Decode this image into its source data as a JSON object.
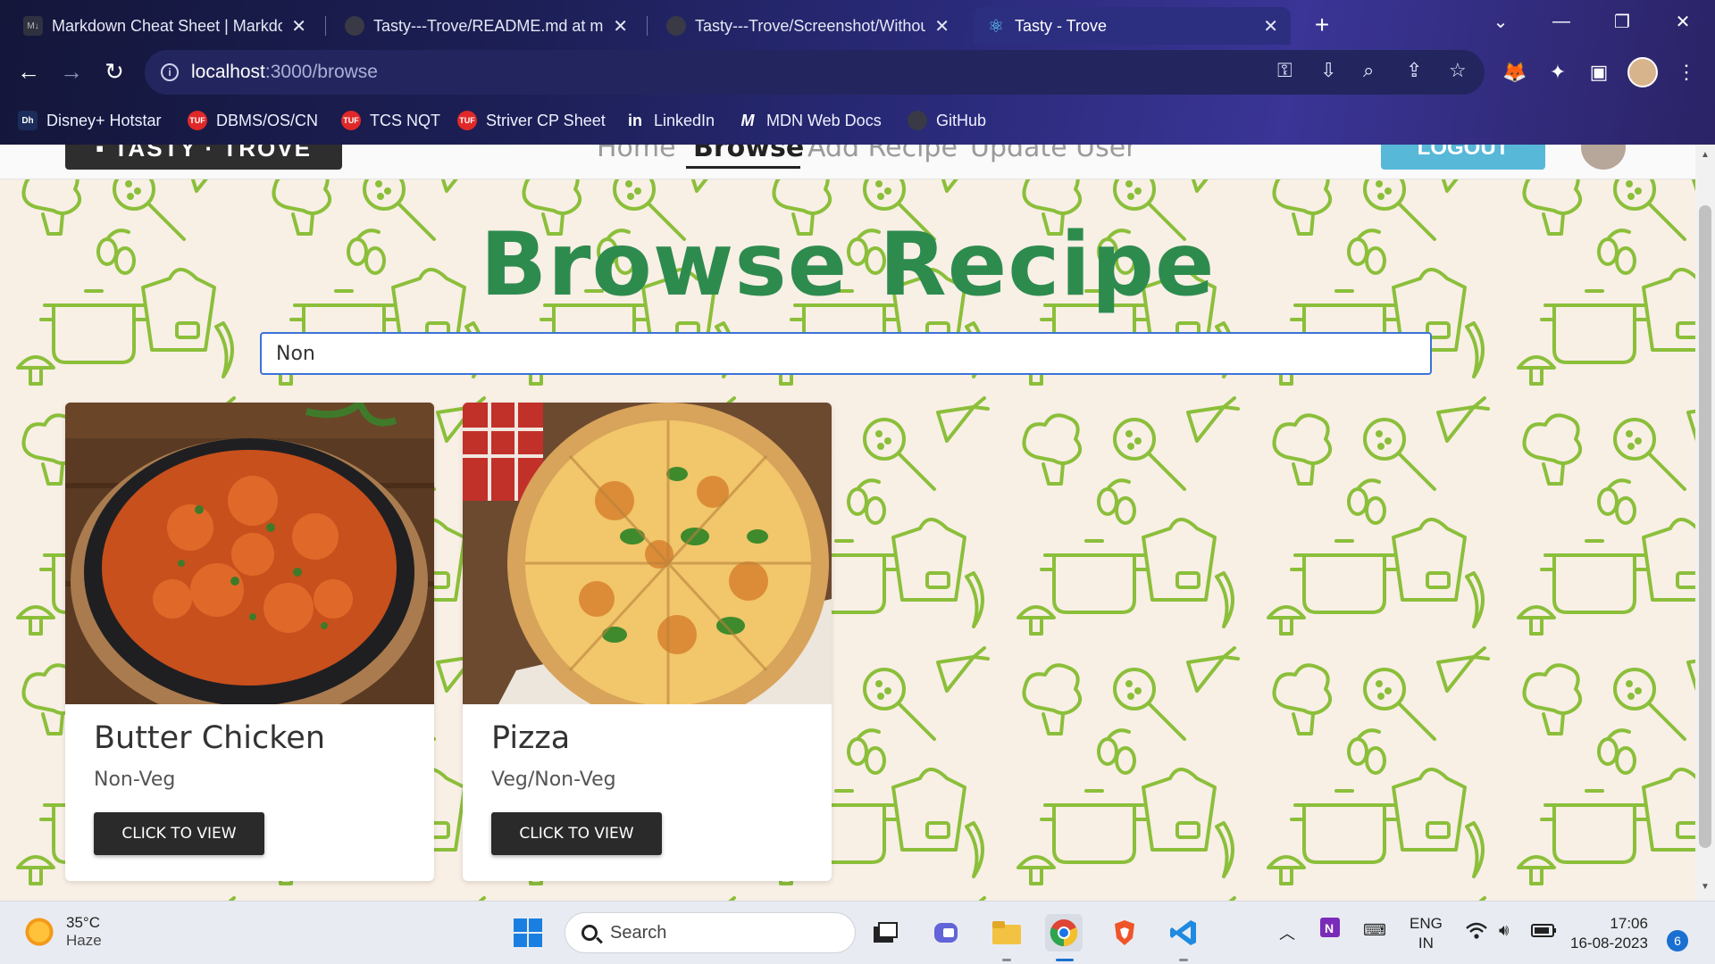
{
  "browser": {
    "tabs": [
      {
        "title": "Markdown Cheat Sheet | Markdo",
        "favicon": "markdown-icon"
      },
      {
        "title": "Tasty---Trove/README.md at ma",
        "favicon": "github-icon"
      },
      {
        "title": "Tasty---Trove/Screenshot/Withou",
        "favicon": "github-icon"
      },
      {
        "title": "Tasty - Trove",
        "favicon": "react-icon",
        "active": true
      }
    ],
    "url_host": "localhost",
    "url_path": ":3000/browse",
    "bookmarks": [
      {
        "label": "Disney+ Hotstar",
        "icon": "hotstar-icon"
      },
      {
        "label": "DBMS/OS/CN",
        "icon": "tuf-icon"
      },
      {
        "label": "TCS NQT",
        "icon": "tuf-icon"
      },
      {
        "label": "Striver CP Sheet",
        "icon": "tuf-icon"
      },
      {
        "label": "LinkedIn",
        "icon": "linkedin-icon"
      },
      {
        "label": "MDN Web Docs",
        "icon": "mdn-icon"
      },
      {
        "label": "GitHub",
        "icon": "github-icon"
      }
    ]
  },
  "app": {
    "heading": "Browse Recipe",
    "search_value": "Non",
    "recipes": [
      {
        "name": "Butter Chicken",
        "category": "Non-Veg",
        "button": "CLICK TO VIEW"
      },
      {
        "name": "Pizza",
        "category": "Veg/Non-Veg",
        "button": "CLICK TO VIEW"
      }
    ]
  },
  "taskbar": {
    "temperature": "35°C",
    "condition": "Haze",
    "search_label": "Search",
    "lang_line1": "ENG",
    "lang_line2": "IN",
    "time": "17:06",
    "date": "16-08-2023",
    "notifications": "6"
  },
  "colors": {
    "title_green": "#2e8b4e",
    "pattern_green": "#8bbf3a",
    "background_cream": "#f8efe5",
    "button_dark": "#2a2a2a",
    "search_border": "#3b73d8"
  }
}
